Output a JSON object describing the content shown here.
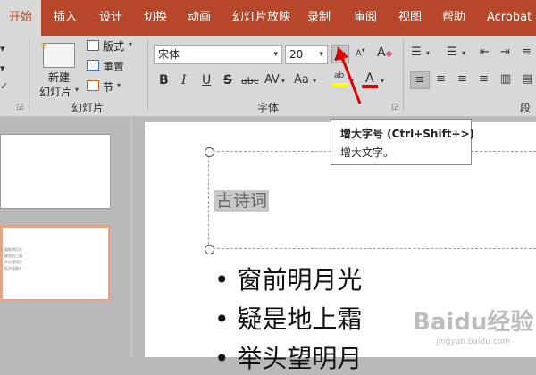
{
  "tabs": [
    "开始",
    "插入",
    "设计",
    "切换",
    "动画",
    "幻灯片放映",
    "录制",
    "审阅",
    "视图",
    "帮助",
    "Acrobat"
  ],
  "ribbon": {
    "new_slide": [
      "新建",
      "幻灯片"
    ],
    "layout": "版式",
    "reset": "重置",
    "section": "节",
    "group_slides": "幻灯片",
    "font_name": "宋体",
    "font_size": "20",
    "group_font": "字体",
    "group_paragraph": "段"
  },
  "tooltip": {
    "title": "增大字号 (Ctrl+Shift+>)",
    "desc": "增大文字。"
  },
  "slide": {
    "title": "古诗词",
    "bullets": [
      "窗前明月光",
      "疑是地上霜",
      "举头望明月"
    ]
  },
  "thumb_lines": [
    "窗前明月光",
    "疑是地上霜",
    "举头望明月",
    "低头思故乡"
  ],
  "watermark": "Baidu经验",
  "watermark_url": "jingyan.baidu.com",
  "colors": {
    "tab_bar": "#b7472a",
    "arrow": "#e00000",
    "highlight": "#ffff00",
    "font_color": "#e00000"
  }
}
